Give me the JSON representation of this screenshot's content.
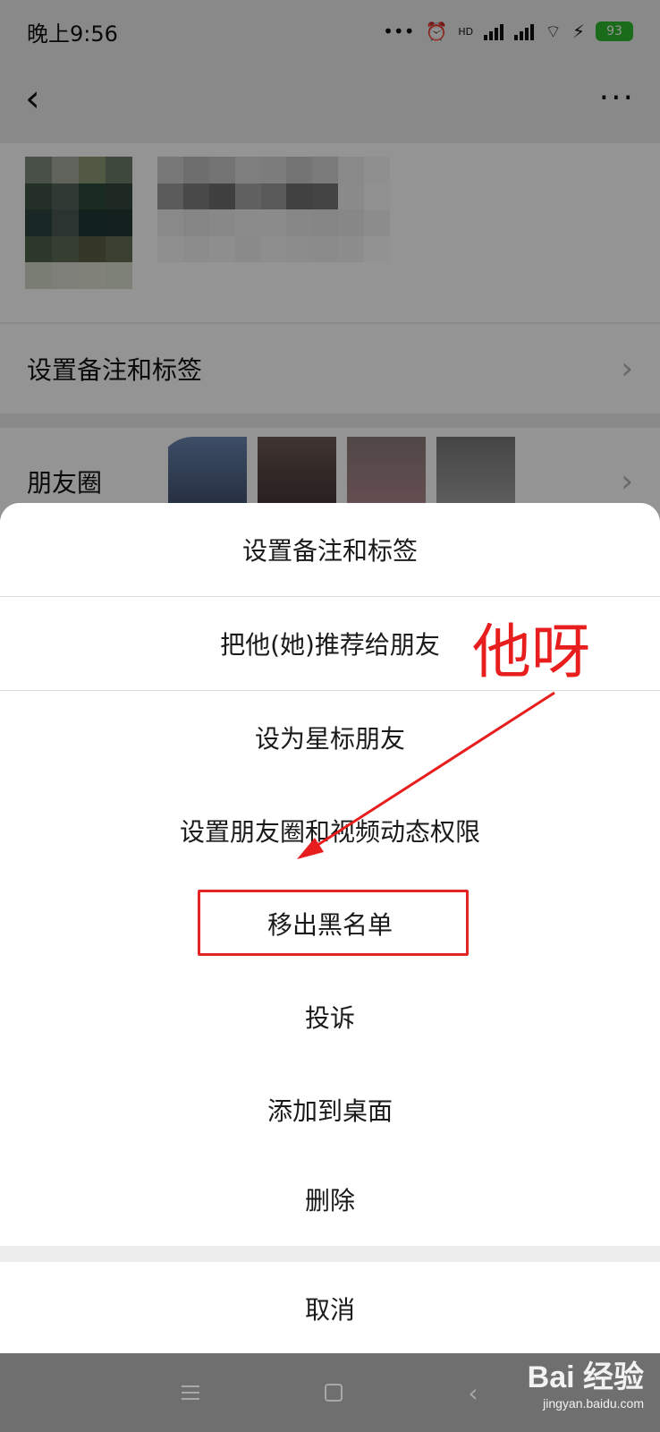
{
  "status_bar": {
    "time": "晚上9:56",
    "dots": "•••",
    "network_badge": "HD",
    "battery": "93"
  },
  "background": {
    "row_remark_label": "设置备注和标签",
    "row_moments_label": "朋友圈"
  },
  "sheet": {
    "items": [
      "设置备注和标签",
      "把他(她)推荐给朋友",
      "设为星标朋友",
      "设置朋友圈和视频动态权限",
      "移出黑名单",
      "投诉",
      "添加到桌面",
      "删除"
    ],
    "cancel": "取消"
  },
  "annotation": {
    "text": "他呀",
    "color": "#e81d1d"
  },
  "watermark": {
    "main": "Bai 经验",
    "sub": "jingyan.baidu.com"
  },
  "colors": {
    "battery": "#2eb82e",
    "highlight": "#e52323"
  }
}
